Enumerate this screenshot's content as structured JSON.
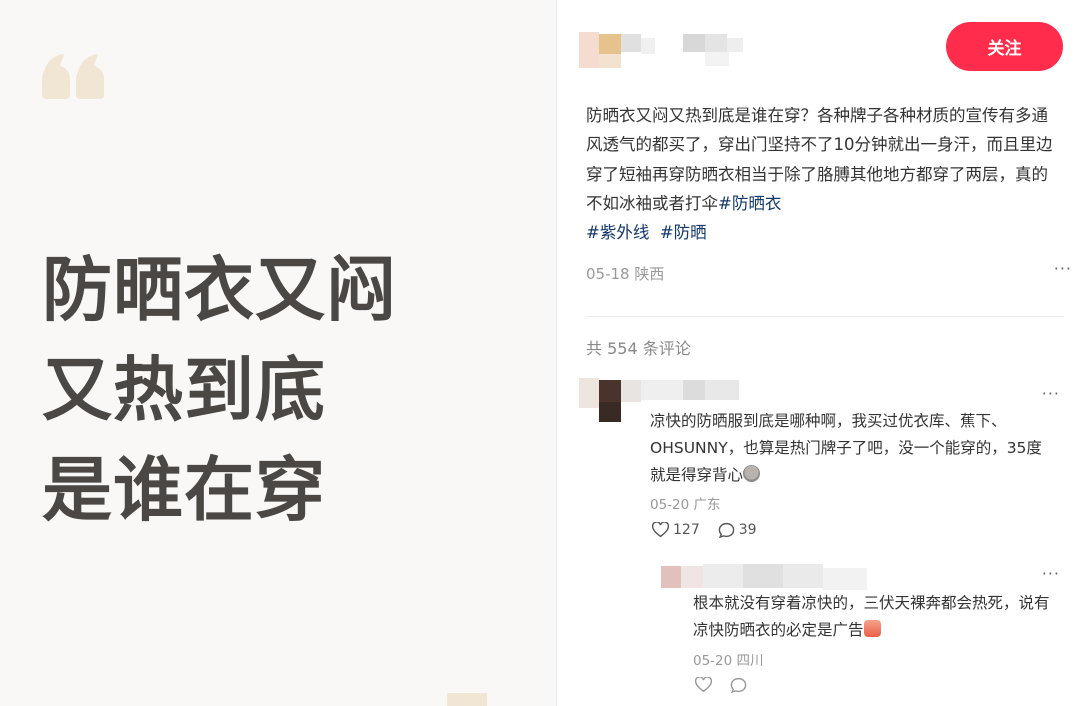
{
  "note_image": {
    "title_lines": [
      "防晒衣又闷",
      "又热到底",
      "是谁在穿"
    ]
  },
  "author": {
    "follow_label": "关注"
  },
  "post": {
    "text": "防晒衣又闷又热到底是谁在穿？各种牌子各种材质的宣传有多通风透气的都买了，穿出门坚持不了10分钟就出一身汗，而且里边穿了短袖再穿防晒衣相当于除了胳膊其他地方都穿了两层，真的不如冰袖或者打伞",
    "tags": [
      "#防晒衣",
      "#紫外线",
      "#防晒"
    ],
    "date_location": "05-18 陕西",
    "more": "···"
  },
  "comments_header": "共 554 条评论",
  "comments": [
    {
      "text": "凉快的防晒服到底是哪种啊，我买过优衣库、蕉下、OHSUNNY，也算是热门牌子了吧，没一个能穿的，35度就是得穿背心",
      "date_location": "05-20 广东",
      "likes": "127",
      "replies": "39",
      "more": "···",
      "emoji": "sweat-emoji"
    },
    {
      "text": "根本就没有穿着凉快的，三伏天裸奔都会热死，说有凉快防晒衣的必定是广告",
      "date_location": "05-20 四川",
      "more": "···",
      "emoji": "crying-emoji"
    }
  ],
  "colors": {
    "accent": "#ff2d4b",
    "tag": "#13386c",
    "image_bg": "#f9f8f6",
    "image_text": "#4a4744"
  }
}
